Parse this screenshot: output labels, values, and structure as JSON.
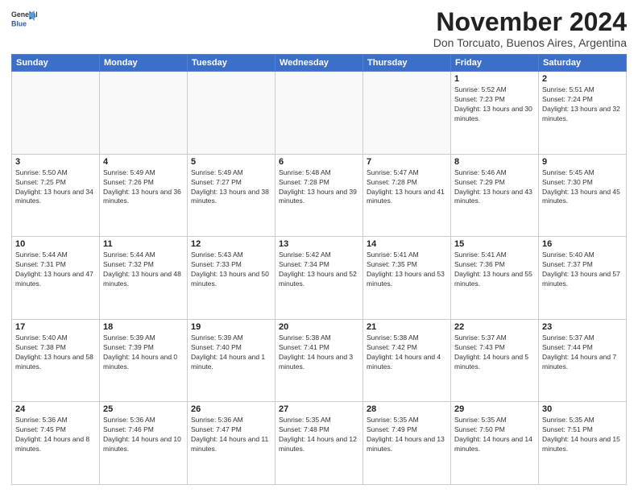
{
  "logo": {
    "general": "General",
    "blue": "Blue"
  },
  "header": {
    "title": "November 2024",
    "location": "Don Torcuato, Buenos Aires, Argentina"
  },
  "days_of_week": [
    "Sunday",
    "Monday",
    "Tuesday",
    "Wednesday",
    "Thursday",
    "Friday",
    "Saturday"
  ],
  "weeks": [
    [
      {
        "day": "",
        "info": ""
      },
      {
        "day": "",
        "info": ""
      },
      {
        "day": "",
        "info": ""
      },
      {
        "day": "",
        "info": ""
      },
      {
        "day": "",
        "info": ""
      },
      {
        "day": "1",
        "info": "Sunrise: 5:52 AM\nSunset: 7:23 PM\nDaylight: 13 hours and 30 minutes."
      },
      {
        "day": "2",
        "info": "Sunrise: 5:51 AM\nSunset: 7:24 PM\nDaylight: 13 hours and 32 minutes."
      }
    ],
    [
      {
        "day": "3",
        "info": "Sunrise: 5:50 AM\nSunset: 7:25 PM\nDaylight: 13 hours and 34 minutes."
      },
      {
        "day": "4",
        "info": "Sunrise: 5:49 AM\nSunset: 7:26 PM\nDaylight: 13 hours and 36 minutes."
      },
      {
        "day": "5",
        "info": "Sunrise: 5:49 AM\nSunset: 7:27 PM\nDaylight: 13 hours and 38 minutes."
      },
      {
        "day": "6",
        "info": "Sunrise: 5:48 AM\nSunset: 7:28 PM\nDaylight: 13 hours and 39 minutes."
      },
      {
        "day": "7",
        "info": "Sunrise: 5:47 AM\nSunset: 7:28 PM\nDaylight: 13 hours and 41 minutes."
      },
      {
        "day": "8",
        "info": "Sunrise: 5:46 AM\nSunset: 7:29 PM\nDaylight: 13 hours and 43 minutes."
      },
      {
        "day": "9",
        "info": "Sunrise: 5:45 AM\nSunset: 7:30 PM\nDaylight: 13 hours and 45 minutes."
      }
    ],
    [
      {
        "day": "10",
        "info": "Sunrise: 5:44 AM\nSunset: 7:31 PM\nDaylight: 13 hours and 47 minutes."
      },
      {
        "day": "11",
        "info": "Sunrise: 5:44 AM\nSunset: 7:32 PM\nDaylight: 13 hours and 48 minutes."
      },
      {
        "day": "12",
        "info": "Sunrise: 5:43 AM\nSunset: 7:33 PM\nDaylight: 13 hours and 50 minutes."
      },
      {
        "day": "13",
        "info": "Sunrise: 5:42 AM\nSunset: 7:34 PM\nDaylight: 13 hours and 52 minutes."
      },
      {
        "day": "14",
        "info": "Sunrise: 5:41 AM\nSunset: 7:35 PM\nDaylight: 13 hours and 53 minutes."
      },
      {
        "day": "15",
        "info": "Sunrise: 5:41 AM\nSunset: 7:36 PM\nDaylight: 13 hours and 55 minutes."
      },
      {
        "day": "16",
        "info": "Sunrise: 5:40 AM\nSunset: 7:37 PM\nDaylight: 13 hours and 57 minutes."
      }
    ],
    [
      {
        "day": "17",
        "info": "Sunrise: 5:40 AM\nSunset: 7:38 PM\nDaylight: 13 hours and 58 minutes."
      },
      {
        "day": "18",
        "info": "Sunrise: 5:39 AM\nSunset: 7:39 PM\nDaylight: 14 hours and 0 minutes."
      },
      {
        "day": "19",
        "info": "Sunrise: 5:39 AM\nSunset: 7:40 PM\nDaylight: 14 hours and 1 minute."
      },
      {
        "day": "20",
        "info": "Sunrise: 5:38 AM\nSunset: 7:41 PM\nDaylight: 14 hours and 3 minutes."
      },
      {
        "day": "21",
        "info": "Sunrise: 5:38 AM\nSunset: 7:42 PM\nDaylight: 14 hours and 4 minutes."
      },
      {
        "day": "22",
        "info": "Sunrise: 5:37 AM\nSunset: 7:43 PM\nDaylight: 14 hours and 5 minutes."
      },
      {
        "day": "23",
        "info": "Sunrise: 5:37 AM\nSunset: 7:44 PM\nDaylight: 14 hours and 7 minutes."
      }
    ],
    [
      {
        "day": "24",
        "info": "Sunrise: 5:36 AM\nSunset: 7:45 PM\nDaylight: 14 hours and 8 minutes."
      },
      {
        "day": "25",
        "info": "Sunrise: 5:36 AM\nSunset: 7:46 PM\nDaylight: 14 hours and 10 minutes."
      },
      {
        "day": "26",
        "info": "Sunrise: 5:36 AM\nSunset: 7:47 PM\nDaylight: 14 hours and 11 minutes."
      },
      {
        "day": "27",
        "info": "Sunrise: 5:35 AM\nSunset: 7:48 PM\nDaylight: 14 hours and 12 minutes."
      },
      {
        "day": "28",
        "info": "Sunrise: 5:35 AM\nSunset: 7:49 PM\nDaylight: 14 hours and 13 minutes."
      },
      {
        "day": "29",
        "info": "Sunrise: 5:35 AM\nSunset: 7:50 PM\nDaylight: 14 hours and 14 minutes."
      },
      {
        "day": "30",
        "info": "Sunrise: 5:35 AM\nSunset: 7:51 PM\nDaylight: 14 hours and 15 minutes."
      }
    ]
  ]
}
